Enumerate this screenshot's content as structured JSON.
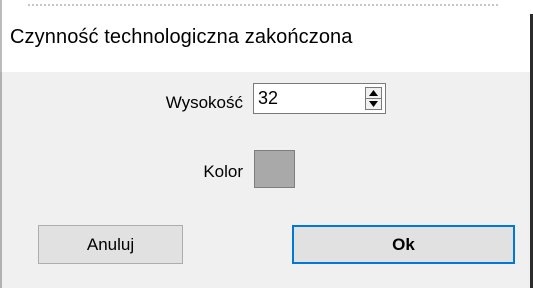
{
  "window": {
    "title": "Czynność technologiczna zakończona"
  },
  "form": {
    "height_label": "Wysokość",
    "height_value": "32",
    "color_label": "Kolor",
    "color_value": "#a9a9a9"
  },
  "buttons": {
    "cancel_label": "Anuluj",
    "ok_label": "Ok"
  },
  "colors": {
    "accent_focus": "#0078d7",
    "window_bg": "#f0f0f0",
    "titlebar_bg": "#ffffff"
  }
}
